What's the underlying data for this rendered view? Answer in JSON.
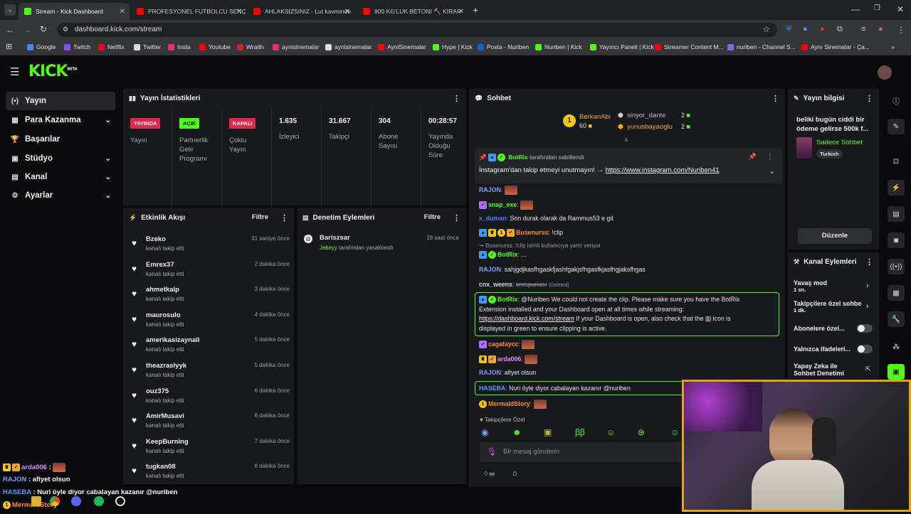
{
  "browser": {
    "tabs": [
      {
        "title": "Stream - Kick Dashboard",
        "color": "#53fc18"
      },
      {
        "title": "PROFESYONEL FUTBOLCU SENÇ",
        "color": "#ff0000"
      },
      {
        "title": "AHLAKSIZSINIZ - Lut kavminde",
        "color": "#ff0000"
      },
      {
        "title": "800 KG'LUK BETONI 🔨 KIRAR",
        "color": "#ff0000"
      }
    ],
    "url": "dashboard.kick.com/stream",
    "bookmarks": [
      {
        "label": "Google",
        "color": "#4285f4"
      },
      {
        "label": "Twitch",
        "color": "#9146ff"
      },
      {
        "label": "Netflix",
        "color": "#e50914"
      },
      {
        "label": "Twitter",
        "color": "#dddddd"
      },
      {
        "label": "Insta",
        "color": "#e1306c"
      },
      {
        "label": "Youtube",
        "color": "#ff0000"
      },
      {
        "label": "Wraith",
        "color": "#cc2222"
      },
      {
        "label": "aynisinemalar",
        "color": "#e1306c"
      },
      {
        "label": "aynisinemalar",
        "color": "#dddddd"
      },
      {
        "label": "AyniSinemalar",
        "color": "#ff0000"
      },
      {
        "label": "Hype | Kick",
        "color": "#53fc18"
      },
      {
        "label": "Posta - Nuriben",
        "color": "#0a66c2"
      },
      {
        "label": "Nuriben | Kick",
        "color": "#53fc18"
      },
      {
        "label": "Yayıncı Paneli | Kick",
        "color": "#53fc18"
      },
      {
        "label": "Streamer Content M...",
        "color": "#ff0000"
      },
      {
        "label": "nuriben - Channel S...",
        "color": "#7b68ee"
      },
      {
        "label": "Aynı Sinemalar - Ça...",
        "color": "#ff0000"
      }
    ]
  },
  "kick": {
    "logo": "KICK",
    "logo_sup": "BETA",
    "sidebar": [
      {
        "label": "Yayın",
        "icon": "(•)"
      },
      {
        "label": "Para Kazanma",
        "icon": "▦"
      },
      {
        "label": "Başarılar",
        "icon": "🏆"
      },
      {
        "label": "Stüdyo",
        "icon": "▣"
      },
      {
        "label": "Kanal",
        "icon": "▤"
      },
      {
        "label": "Ayarlar",
        "icon": "⚙"
      }
    ],
    "stats": {
      "title": "Yayın İstatistikleri",
      "items": [
        {
          "badge": "YAYINDA",
          "label": "Yayın",
          "badge_color": "#e0264a",
          "badge_text": "#ffffff"
        },
        {
          "badge": "AÇIK",
          "label": "Partnerlik Gelir Programı",
          "badge_color": "#53fc18",
          "badge_text": "#0b0b0d"
        },
        {
          "badge": "KAPALI",
          "label": "Çoklu Yayın",
          "badge_color": "#e0264a",
          "badge_text": "#ffffff"
        },
        {
          "value": "1.635",
          "label": "İzleyici"
        },
        {
          "value": "31.667",
          "label": "Takipçi"
        },
        {
          "value": "304",
          "label": "Abone Sayısı"
        },
        {
          "value": "00:28:57",
          "label": "Yayında Olduğu Süre"
        }
      ]
    },
    "activity": {
      "title": "Etkinlik Akışı",
      "filter": "Filtre",
      "items": [
        {
          "name": "Bzeko",
          "sub": "kanalı takip etti",
          "time": "31 saniye önce"
        },
        {
          "name": "Emrex37",
          "sub": "kanalı takip etti",
          "time": "2 dakika önce"
        },
        {
          "name": "ahmetkalp",
          "sub": "kanalı takip etti",
          "time": "3 dakika önce"
        },
        {
          "name": "maurosulo",
          "sub": "kanalı takip etti",
          "time": "4 dakika önce"
        },
        {
          "name": "amerikasizaynali",
          "sub": "kanalı takip etti",
          "time": "5 dakika önce"
        },
        {
          "name": "theazraslyyk",
          "sub": "kanalı takip etti",
          "time": "5 dakika önce"
        },
        {
          "name": "ouz375",
          "sub": "kanalı takip etti",
          "time": "6 dakika önce"
        },
        {
          "name": "AmirMusavi",
          "sub": "kanalı takip etti",
          "time": "6 dakika önce"
        },
        {
          "name": "KeepBurning",
          "sub": "kanalı takip etti",
          "time": "7 dakika önce"
        },
        {
          "name": "tugkan08",
          "sub": "kanalı takip etti",
          "time": "8 dakika önce"
        }
      ]
    },
    "moderation": {
      "title": "Denetim Eylemleri",
      "filter": "Filtre",
      "item": {
        "name": "Bariszsar",
        "by": "Jekeyy",
        "sub": "tarafından yasaklandı",
        "time": "18 saat önce"
      }
    },
    "chat": {
      "title": "Sohbet",
      "top": [
        {
          "name": "BerkanAbi",
          "count": "60",
          "color": "#f5a623"
        },
        {
          "name": "sinyor_dante",
          "count": "2",
          "color": "#aaaaaa"
        },
        {
          "name": "yunushayaoglu",
          "count": "2",
          "color": "#f5a623"
        }
      ],
      "pinned": {
        "user": "BotRix",
        "by": "tarafından sabitlendi",
        "text": "İnstagram'dan takip etmeyi unutmayın! →",
        "link": "https://www.instagram.com/Nuriben41"
      },
      "messages": [
        {
          "user": "RAJON",
          "text": "",
          "color": "#7a9cff"
        },
        {
          "user": "snap_exe",
          "text": "",
          "color": "#53fc18"
        },
        {
          "user": "x_duman",
          "text": "Son durak olarak da Rammus53 e git",
          "color": "#4a7dff"
        },
        {
          "user": "Busenurss",
          "text": "!clip",
          "color": "#ff8c1a"
        },
        {
          "reply": "Busenurss: !clip isimli kullanıcıya yanıt veriyor"
        },
        {
          "user": "BotRix",
          "text": "...",
          "color": "#53fc18"
        },
        {
          "user": "RAJON",
          "text": "sahjgdjkasfhgaskfjashfgakjsfhgasfkjasfhgjaksfhgas",
          "color": "#7a9cff"
        },
        {
          "user": "cnx_weens",
          "text": "orospunası",
          "deleted": "(Deleted)",
          "color": "#cfcfcf"
        },
        {
          "user": "BotRix",
          "text": "@Nuriben We could not create the clip. Please make sure you have the BotRix",
          "color": "#53fc18"
        },
        {
          "text": "Extension installed and your Dashboard open at all times while streaming:"
        },
        {
          "link": "https://dashboard.kick.com/stream",
          "text": " If your Dashboard is open, also check that the ▥ icon is"
        },
        {
          "text": "displayed in green to ensure clipping is active."
        },
        {
          "user": "cagataycc",
          "text": "",
          "color": "#ff8c1a"
        },
        {
          "user": "arda006",
          "text": "",
          "color": "#d98cff"
        },
        {
          "user": "RAJON",
          "text": "afiyet olsun",
          "color": "#7a9cff"
        },
        {
          "user": "HASEBA",
          "text": "Nuri öyle diyor cabalayan kazanır @nuriben",
          "color": "#4a9dff"
        },
        {
          "user": "MermaidStory",
          "text": "",
          "color": "#ff8c1a"
        }
      ],
      "followers_only": "Takipçilere Özel",
      "placeholder": "Bir mesaj gönderin"
    },
    "info": {
      "title": "Yayın bilgisi",
      "stream_title": "beliki bugün ciddi bir ödeme gelirse 500k f...",
      "category": "Sadece Sohbet",
      "tag": "Turkish",
      "edit": "Düzenle"
    },
    "channel_actions": {
      "title": "Kanal Eylemleri",
      "slow": "Yavaş mod",
      "slow_val": "1 sn.",
      "follower": "Takipçilere özel sohbe",
      "follower_val": "1 dk.",
      "subs": "Abonelere özel...",
      "emotes": "Yalnızca ifadeleri...",
      "ai": "Yapay Zeka ile Sohbet Denetimi"
    }
  },
  "overlay": [
    {
      "user": "arda006",
      "text": ":",
      "color": "#d98cff"
    },
    {
      "user": "RAJON",
      "text": ": afiyet olsun",
      "color": "#7a9cff"
    },
    {
      "user": "HASEBA",
      "text": ": Nuri öyle diyor cabalayan kazanır @nuriben",
      "color": "#4a9dff"
    },
    {
      "user": "MermaidStory",
      "text": "",
      "color": "#ff8c1a"
    }
  ]
}
